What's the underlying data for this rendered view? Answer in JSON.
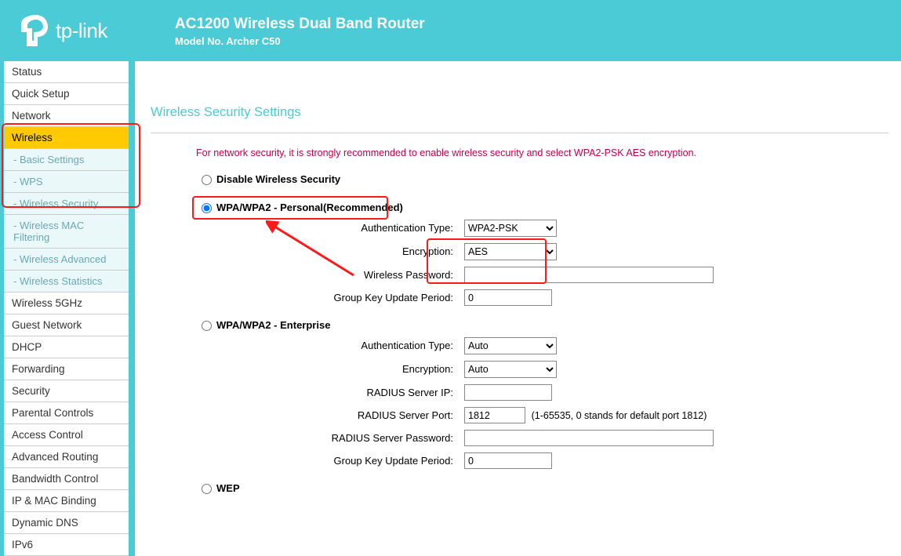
{
  "header": {
    "brand": "tp-link",
    "title": "AC1200 Wireless Dual Band Router",
    "subtitle": "Model No. Archer C50"
  },
  "sidebar": {
    "items": [
      {
        "label": "Status",
        "type": "item"
      },
      {
        "label": "Quick Setup",
        "type": "item"
      },
      {
        "label": "Network",
        "type": "item"
      },
      {
        "label": "Wireless",
        "type": "active"
      },
      {
        "label": "- Basic Settings",
        "type": "sub"
      },
      {
        "label": "- WPS",
        "type": "sub"
      },
      {
        "label": "- Wireless Security",
        "type": "sub"
      },
      {
        "label": "- Wireless MAC Filtering",
        "type": "sub"
      },
      {
        "label": "- Wireless Advanced",
        "type": "sub"
      },
      {
        "label": "- Wireless Statistics",
        "type": "sub"
      },
      {
        "label": "Wireless 5GHz",
        "type": "item"
      },
      {
        "label": "Guest Network",
        "type": "item"
      },
      {
        "label": "DHCP",
        "type": "item"
      },
      {
        "label": "Forwarding",
        "type": "item"
      },
      {
        "label": "Security",
        "type": "item"
      },
      {
        "label": "Parental Controls",
        "type": "item"
      },
      {
        "label": "Access Control",
        "type": "item"
      },
      {
        "label": "Advanced Routing",
        "type": "item"
      },
      {
        "label": "Bandwidth Control",
        "type": "item"
      },
      {
        "label": "IP & MAC Binding",
        "type": "item"
      },
      {
        "label": "Dynamic DNS",
        "type": "item"
      },
      {
        "label": "IPv6",
        "type": "item"
      }
    ]
  },
  "page": {
    "title": "Wireless Security Settings",
    "notice": "For network security, it is strongly recommended to enable wireless security and select WPA2-PSK AES encryption.",
    "options": {
      "disable": "Disable Wireless Security",
      "personal": "WPA/WPA2 - Personal(Recommended)",
      "enterprise": "WPA/WPA2 - Enterprise",
      "wep": "WEP"
    },
    "labels": {
      "auth_type": "Authentication Type:",
      "encryption": "Encryption:",
      "wireless_pwd": "Wireless Password:",
      "group_key": "Group Key Update Period:",
      "radius_ip": "RADIUS Server IP:",
      "radius_port": "RADIUS Server Port:",
      "radius_pwd": "RADIUS Server Password:"
    },
    "personal": {
      "auth_type": "WPA2-PSK",
      "encryption": "AES",
      "wireless_pwd": "",
      "group_key": "0"
    },
    "enterprise": {
      "auth_type": "Auto",
      "encryption": "Auto",
      "radius_ip": "",
      "radius_port": "1812",
      "radius_port_hint": "(1-65535, 0 stands for default port 1812)",
      "radius_pwd": "",
      "group_key": "0"
    }
  }
}
